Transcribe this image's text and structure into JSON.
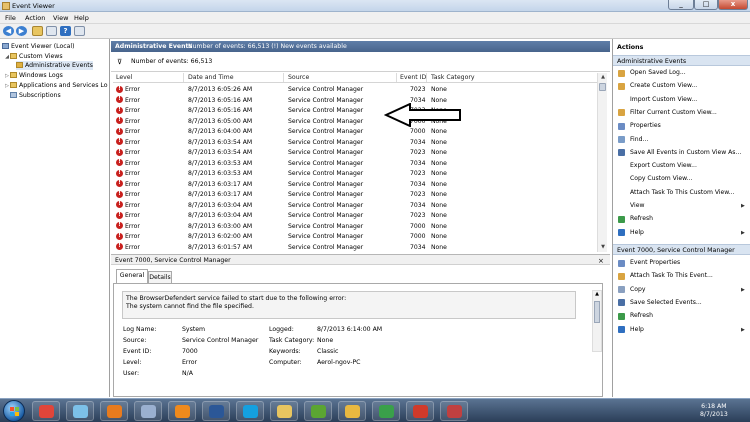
{
  "window": {
    "title": "Event Viewer",
    "min": "_",
    "max": "□",
    "close": "x"
  },
  "menu": [
    "File",
    "Action",
    "View",
    "Help"
  ],
  "toolbar_icons": [
    "back-icon",
    "forward-icon",
    "folder-icon",
    "properties-icon",
    "help-icon",
    "console-icon"
  ],
  "tree": [
    {
      "label": "Event Viewer (Local)",
      "level": 0,
      "expander": ""
    },
    {
      "label": "Custom Views",
      "level": 1,
      "expander": "◢"
    },
    {
      "label": "Administrative Events",
      "level": 2,
      "expander": ""
    },
    {
      "label": "Windows Logs",
      "level": 1,
      "expander": "▷"
    },
    {
      "label": "Applications and Services Lo",
      "level": 1,
      "expander": "▷"
    },
    {
      "label": "Subscriptions",
      "level": 1,
      "expander": ""
    }
  ],
  "header": {
    "title": "Administrative Events",
    "count": "Number of events: 66,513 (!) New events available"
  },
  "filter": {
    "text": "Number of events: 66,513"
  },
  "columns": [
    "Level",
    "Date and Time",
    "Source",
    "Event ID",
    "Task Category"
  ],
  "rows": [
    {
      "level": "Error",
      "date": "8/7/2013 6:05:26 AM",
      "source": "Service Control Manager",
      "id": "7023",
      "cat": "None"
    },
    {
      "level": "Error",
      "date": "8/7/2013 6:05:16 AM",
      "source": "Service Control Manager",
      "id": "7034",
      "cat": "None"
    },
    {
      "level": "Error",
      "date": "8/7/2013 6:05:16 AM",
      "source": "Service Control Manager",
      "id": "7023",
      "cat": "None"
    },
    {
      "level": "Error",
      "date": "8/7/2013 6:05:00 AM",
      "source": "Service Control Manager",
      "id": "7000",
      "cat": "None"
    },
    {
      "level": "Error",
      "date": "8/7/2013 6:04:00 AM",
      "source": "Service Control Manager",
      "id": "7000",
      "cat": "None"
    },
    {
      "level": "Error",
      "date": "8/7/2013 6:03:54 AM",
      "source": "Service Control Manager",
      "id": "7034",
      "cat": "None"
    },
    {
      "level": "Error",
      "date": "8/7/2013 6:03:54 AM",
      "source": "Service Control Manager",
      "id": "7023",
      "cat": "None"
    },
    {
      "level": "Error",
      "date": "8/7/2013 6:03:53 AM",
      "source": "Service Control Manager",
      "id": "7034",
      "cat": "None"
    },
    {
      "level": "Error",
      "date": "8/7/2013 6:03:53 AM",
      "source": "Service Control Manager",
      "id": "7023",
      "cat": "None"
    },
    {
      "level": "Error",
      "date": "8/7/2013 6:03:17 AM",
      "source": "Service Control Manager",
      "id": "7034",
      "cat": "None"
    },
    {
      "level": "Error",
      "date": "8/7/2013 6:03:17 AM",
      "source": "Service Control Manager",
      "id": "7023",
      "cat": "None"
    },
    {
      "level": "Error",
      "date": "8/7/2013 6:03:04 AM",
      "source": "Service Control Manager",
      "id": "7034",
      "cat": "None"
    },
    {
      "level": "Error",
      "date": "8/7/2013 6:03:04 AM",
      "source": "Service Control Manager",
      "id": "7023",
      "cat": "None"
    },
    {
      "level": "Error",
      "date": "8/7/2013 6:03:00 AM",
      "source": "Service Control Manager",
      "id": "7000",
      "cat": "None"
    },
    {
      "level": "Error",
      "date": "8/7/2013 6:02:00 AM",
      "source": "Service Control Manager",
      "id": "7000",
      "cat": "None"
    },
    {
      "level": "Error",
      "date": "8/7/2013 6:01:57 AM",
      "source": "Service Control Manager",
      "id": "7034",
      "cat": "None"
    }
  ],
  "detail": {
    "header": "Event 7000, Service Control Manager",
    "tabs": [
      "General",
      "Details"
    ],
    "message_line1": "The BrowserDefendert service failed to start due to the following error:",
    "message_line2": "The system cannot find the file specified.",
    "left": [
      {
        "k": "Log Name:",
        "v": "System"
      },
      {
        "k": "Source:",
        "v": "Service Control Manager"
      },
      {
        "k": "Event ID:",
        "v": "7000"
      },
      {
        "k": "Level:",
        "v": "Error"
      },
      {
        "k": "User:",
        "v": "N/A"
      }
    ],
    "right": [
      {
        "k": "Logged:",
        "v": "8/7/2013 6:14:00 AM"
      },
      {
        "k": "Task Category:",
        "v": "None"
      },
      {
        "k": "Keywords:",
        "v": "Classic"
      },
      {
        "k": "Computer:",
        "v": "Aerol-ngov-PC"
      }
    ]
  },
  "actions": {
    "title": "Actions",
    "section1": "Administrative Events",
    "items1": [
      {
        "label": "Open Saved Log...",
        "icon": "open-log-icon",
        "color": "#d9a441",
        "sub": ""
      },
      {
        "label": "Create Custom View...",
        "icon": "filter-icon",
        "color": "#d9a441",
        "sub": ""
      },
      {
        "label": "Import Custom View...",
        "icon": "import-icon",
        "color": "",
        "sub": ""
      },
      {
        "label": "Filter Current Custom View...",
        "icon": "filter-icon",
        "color": "#d9a441",
        "sub": ""
      },
      {
        "label": "Properties",
        "icon": "properties-icon",
        "color": "#6b8cc4",
        "sub": ""
      },
      {
        "label": "Find...",
        "icon": "find-icon",
        "color": "#7a9cc8",
        "sub": ""
      },
      {
        "label": "Save All Events in Custom View As...",
        "icon": "save-icon",
        "color": "#4a6fa5",
        "sub": ""
      },
      {
        "label": "Export Custom View...",
        "icon": "export-icon",
        "color": "",
        "sub": ""
      },
      {
        "label": "Copy Custom View...",
        "icon": "copy-icon",
        "color": "",
        "sub": ""
      },
      {
        "label": "Attach Task To This Custom View...",
        "icon": "task-icon",
        "color": "",
        "sub": ""
      },
      {
        "label": "View",
        "icon": "view-icon",
        "color": "",
        "sub": "▶"
      },
      {
        "label": "Refresh",
        "icon": "refresh-icon",
        "color": "#3c9a4a",
        "sub": ""
      },
      {
        "label": "Help",
        "icon": "help-icon",
        "color": "#2f6fc0",
        "sub": "▶"
      }
    ],
    "section2": "Event 7000, Service Control Manager",
    "items2": [
      {
        "label": "Event Properties",
        "icon": "event-properties-icon",
        "color": "#6b8cc4",
        "sub": ""
      },
      {
        "label": "Attach Task To This Event...",
        "icon": "task-icon",
        "color": "#d9a441",
        "sub": ""
      },
      {
        "label": "Copy",
        "icon": "copy-icon",
        "color": "#8aa0c0",
        "sub": "▶"
      },
      {
        "label": "Save Selected Events...",
        "icon": "save-icon",
        "color": "#4a6fa5",
        "sub": ""
      },
      {
        "label": "Refresh",
        "icon": "refresh-icon",
        "color": "#3c9a4a",
        "sub": ""
      },
      {
        "label": "Help",
        "icon": "help-icon",
        "color": "#2f6fc0",
        "sub": "▶"
      }
    ]
  },
  "taskbar": {
    "apps": [
      {
        "name": "chrome-app",
        "color": "#e0453a"
      },
      {
        "name": "sticky-notes-app",
        "color": "#7cc0e8"
      },
      {
        "name": "firefox-app",
        "color": "#e87b1e"
      },
      {
        "name": "network-app",
        "color": "#9ab0d0"
      },
      {
        "name": "vlc-app",
        "color": "#f08a1c"
      },
      {
        "name": "word-app",
        "color": "#2b5797"
      },
      {
        "name": "skype-app",
        "color": "#14a0e0"
      },
      {
        "name": "explorer-app",
        "color": "#e8c560"
      },
      {
        "name": "utorrent-app",
        "color": "#5ba532"
      },
      {
        "name": "photo-app",
        "color": "#e8b840"
      },
      {
        "name": "greenshot-app",
        "color": "#3aa04a"
      },
      {
        "name": "media-app",
        "color": "#d03a2a"
      },
      {
        "name": "toolbox-app",
        "color": "#c04040"
      }
    ],
    "time": "6:18 AM",
    "date": "8/7/2013"
  }
}
